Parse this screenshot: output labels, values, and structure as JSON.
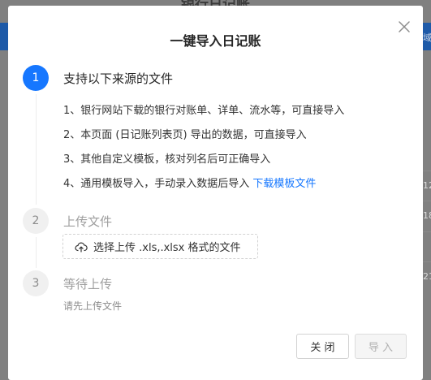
{
  "background": {
    "page_title": "银行日记账",
    "right_snippets": [
      "域",
      "12",
      "18",
      "21"
    ]
  },
  "modal": {
    "title": "一键导入日记账",
    "close_icon": "close-icon"
  },
  "steps": [
    {
      "number": "1",
      "title": "支持以下来源的文件",
      "status": "active",
      "items": [
        "1、银行网站下载的银行对账单、详单、流水等，可直接导入",
        "2、本页面 (日记账列表页) 导出的数据，可直接导入",
        "3、其他自定义模板，核对列名后可正确导入",
        "4、通用模板导入，手动录入数据后导入"
      ],
      "link": "下载模板文件"
    },
    {
      "number": "2",
      "title": "上传文件",
      "status": "wait",
      "upload_label": "选择上传 .xls,.xlsx 格式的文件",
      "upload_icon": "upload-icon"
    },
    {
      "number": "3",
      "title": "等待上传",
      "status": "wait",
      "hint": "请先上传文件"
    }
  ],
  "footer": {
    "close_label": "关 闭",
    "import_label": "导 入"
  },
  "colors": {
    "primary": "#1677ff",
    "overlay": "#808080"
  }
}
